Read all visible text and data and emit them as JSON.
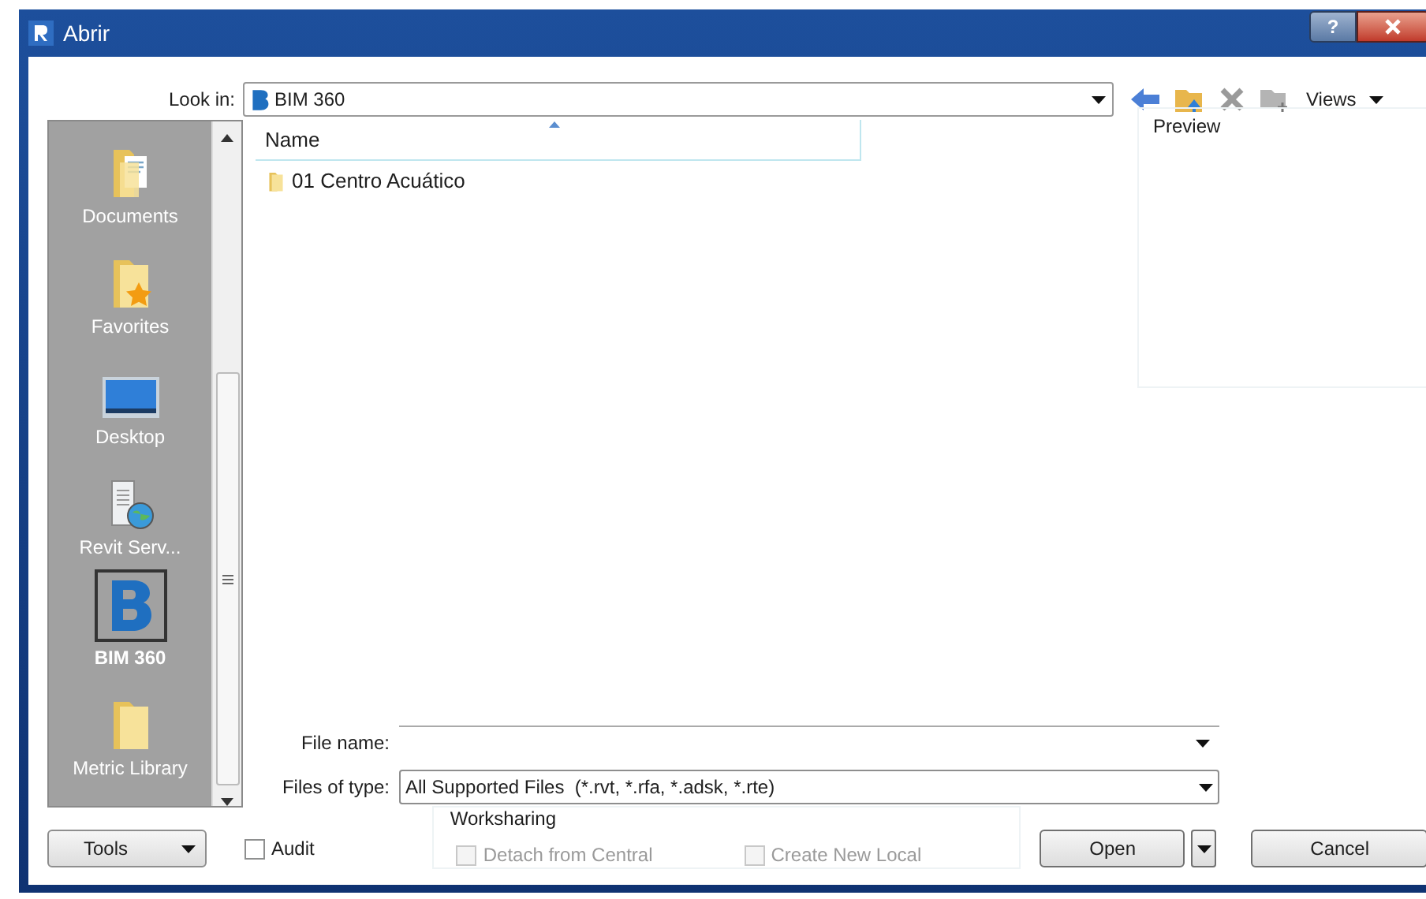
{
  "window": {
    "title": "Abrir",
    "help": "?"
  },
  "look_in": {
    "label": "Look in:",
    "value": "BIM 360"
  },
  "toolbar": {
    "views": "Views"
  },
  "places": [
    {
      "label": "Documents",
      "kind": "documents",
      "selected": false
    },
    {
      "label": "Favorites",
      "kind": "favorites",
      "selected": false
    },
    {
      "label": "Desktop",
      "kind": "desktop",
      "selected": false
    },
    {
      "label": "Revit Serv...",
      "kind": "server",
      "selected": false
    },
    {
      "label": "BIM 360",
      "kind": "bim",
      "selected": true
    },
    {
      "label": "Metric Library",
      "kind": "folder",
      "selected": false
    }
  ],
  "file_list": {
    "columns": [
      "Name"
    ],
    "rows": [
      {
        "name": "01 Centro Acuático"
      }
    ]
  },
  "preview": {
    "label": "Preview"
  },
  "file_name": {
    "label": "File name:"
  },
  "files_of_type": {
    "label": "Files of type:",
    "value": "All Supported Files  (*.rvt, *.rfa, *.adsk, *.rte)"
  },
  "tools": "Tools",
  "audit": {
    "label": "Audit",
    "checked": false
  },
  "worksharing": {
    "title": "Worksharing",
    "options": [
      {
        "label": "Detach from Central",
        "checked": false,
        "disabled": true
      },
      {
        "label": "Create New Local",
        "checked": false,
        "disabled": true
      }
    ]
  },
  "buttons": {
    "open": "Open",
    "cancel": "Cancel"
  }
}
